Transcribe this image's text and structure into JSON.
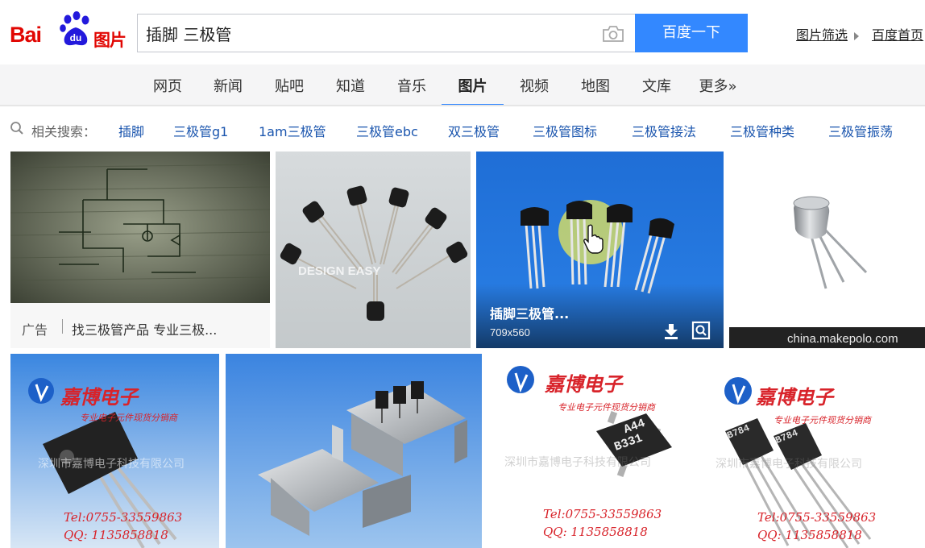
{
  "logo": {
    "text_bai": "Bai",
    "text_du": "du",
    "text_tupian": "图片"
  },
  "search": {
    "query": "插脚 三极管",
    "button_label": "百度一下"
  },
  "top_links": {
    "filter": "图片筛选",
    "home": "百度首页"
  },
  "nav_tabs": [
    "网页",
    "新闻",
    "贴吧",
    "知道",
    "音乐",
    "图片",
    "视频",
    "地图",
    "文库",
    "更多»"
  ],
  "related": {
    "label": "相关搜索：",
    "items": [
      "插脚",
      "三极管g1",
      "1am三极管",
      "三极管ebc",
      "双三极管",
      "三极管图标",
      "三极管接法",
      "三极管种类",
      "三极管振荡"
    ]
  },
  "results": {
    "ad_tag": "广告",
    "ad_title": "找三极管产品 专业三极...",
    "hover_title": "插脚三极管...",
    "hover_size": "709x560",
    "watermark_design": "DESIGN EASY",
    "watermark_makepolo": "china.makepolo.com",
    "brand_name": "嘉博电子",
    "brand_sub": "专业电子元件现货分销商",
    "tel": "Tel:0755-33559863",
    "qq": "QQ: 1135858818",
    "company_wm": "深圳市嘉博电子科技有限公司",
    "chip1": "A44",
    "chip2": "B331",
    "chip_b784": "B784"
  },
  "colors": {
    "accent": "#3388ff",
    "brand_red": "#e10602",
    "link_blue": "#1a55ae",
    "watermark_red": "#d8232a"
  },
  "icons": [
    "baidu-paw-icon",
    "camera-icon",
    "search-icon",
    "download-icon",
    "zoom-icon",
    "cursor-icon"
  ]
}
